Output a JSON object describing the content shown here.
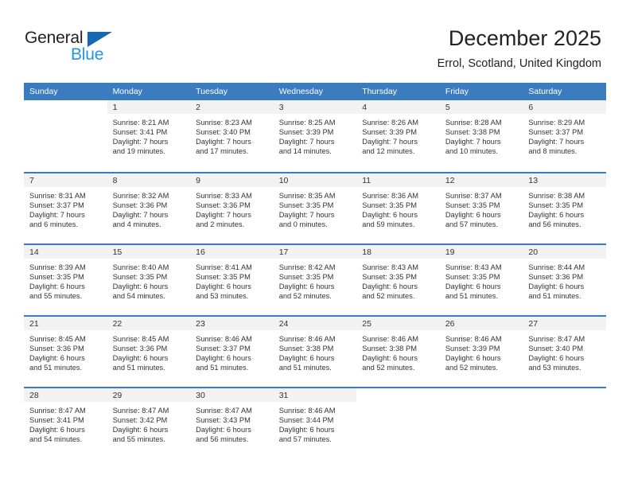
{
  "logo": {
    "text_dark": "General",
    "text_blue": "Blue",
    "accent_color": "#1668b3",
    "blue_color": "#2196e3"
  },
  "header": {
    "title": "December 2025",
    "subtitle": "Errol, Scotland, United Kingdom",
    "header_bg": "#3a7cbe",
    "band_bg": "#f2f2f2"
  },
  "weekday_headers": [
    "Sunday",
    "Monday",
    "Tuesday",
    "Wednesday",
    "Thursday",
    "Friday",
    "Saturday"
  ],
  "weeks": [
    [
      {
        "day": "",
        "sunrise": "",
        "sunset": "",
        "daylight_1": "",
        "daylight_2": ""
      },
      {
        "day": "1",
        "sunrise": "Sunrise: 8:21 AM",
        "sunset": "Sunset: 3:41 PM",
        "daylight_1": "Daylight: 7 hours",
        "daylight_2": "and 19 minutes."
      },
      {
        "day": "2",
        "sunrise": "Sunrise: 8:23 AM",
        "sunset": "Sunset: 3:40 PM",
        "daylight_1": "Daylight: 7 hours",
        "daylight_2": "and 17 minutes."
      },
      {
        "day": "3",
        "sunrise": "Sunrise: 8:25 AM",
        "sunset": "Sunset: 3:39 PM",
        "daylight_1": "Daylight: 7 hours",
        "daylight_2": "and 14 minutes."
      },
      {
        "day": "4",
        "sunrise": "Sunrise: 8:26 AM",
        "sunset": "Sunset: 3:39 PM",
        "daylight_1": "Daylight: 7 hours",
        "daylight_2": "and 12 minutes."
      },
      {
        "day": "5",
        "sunrise": "Sunrise: 8:28 AM",
        "sunset": "Sunset: 3:38 PM",
        "daylight_1": "Daylight: 7 hours",
        "daylight_2": "and 10 minutes."
      },
      {
        "day": "6",
        "sunrise": "Sunrise: 8:29 AM",
        "sunset": "Sunset: 3:37 PM",
        "daylight_1": "Daylight: 7 hours",
        "daylight_2": "and 8 minutes."
      }
    ],
    [
      {
        "day": "7",
        "sunrise": "Sunrise: 8:31 AM",
        "sunset": "Sunset: 3:37 PM",
        "daylight_1": "Daylight: 7 hours",
        "daylight_2": "and 6 minutes."
      },
      {
        "day": "8",
        "sunrise": "Sunrise: 8:32 AM",
        "sunset": "Sunset: 3:36 PM",
        "daylight_1": "Daylight: 7 hours",
        "daylight_2": "and 4 minutes."
      },
      {
        "day": "9",
        "sunrise": "Sunrise: 8:33 AM",
        "sunset": "Sunset: 3:36 PM",
        "daylight_1": "Daylight: 7 hours",
        "daylight_2": "and 2 minutes."
      },
      {
        "day": "10",
        "sunrise": "Sunrise: 8:35 AM",
        "sunset": "Sunset: 3:35 PM",
        "daylight_1": "Daylight: 7 hours",
        "daylight_2": "and 0 minutes."
      },
      {
        "day": "11",
        "sunrise": "Sunrise: 8:36 AM",
        "sunset": "Sunset: 3:35 PM",
        "daylight_1": "Daylight: 6 hours",
        "daylight_2": "and 59 minutes."
      },
      {
        "day": "12",
        "sunrise": "Sunrise: 8:37 AM",
        "sunset": "Sunset: 3:35 PM",
        "daylight_1": "Daylight: 6 hours",
        "daylight_2": "and 57 minutes."
      },
      {
        "day": "13",
        "sunrise": "Sunrise: 8:38 AM",
        "sunset": "Sunset: 3:35 PM",
        "daylight_1": "Daylight: 6 hours",
        "daylight_2": "and 56 minutes."
      }
    ],
    [
      {
        "day": "14",
        "sunrise": "Sunrise: 8:39 AM",
        "sunset": "Sunset: 3:35 PM",
        "daylight_1": "Daylight: 6 hours",
        "daylight_2": "and 55 minutes."
      },
      {
        "day": "15",
        "sunrise": "Sunrise: 8:40 AM",
        "sunset": "Sunset: 3:35 PM",
        "daylight_1": "Daylight: 6 hours",
        "daylight_2": "and 54 minutes."
      },
      {
        "day": "16",
        "sunrise": "Sunrise: 8:41 AM",
        "sunset": "Sunset: 3:35 PM",
        "daylight_1": "Daylight: 6 hours",
        "daylight_2": "and 53 minutes."
      },
      {
        "day": "17",
        "sunrise": "Sunrise: 8:42 AM",
        "sunset": "Sunset: 3:35 PM",
        "daylight_1": "Daylight: 6 hours",
        "daylight_2": "and 52 minutes."
      },
      {
        "day": "18",
        "sunrise": "Sunrise: 8:43 AM",
        "sunset": "Sunset: 3:35 PM",
        "daylight_1": "Daylight: 6 hours",
        "daylight_2": "and 52 minutes."
      },
      {
        "day": "19",
        "sunrise": "Sunrise: 8:43 AM",
        "sunset": "Sunset: 3:35 PM",
        "daylight_1": "Daylight: 6 hours",
        "daylight_2": "and 51 minutes."
      },
      {
        "day": "20",
        "sunrise": "Sunrise: 8:44 AM",
        "sunset": "Sunset: 3:36 PM",
        "daylight_1": "Daylight: 6 hours",
        "daylight_2": "and 51 minutes."
      }
    ],
    [
      {
        "day": "21",
        "sunrise": "Sunrise: 8:45 AM",
        "sunset": "Sunset: 3:36 PM",
        "daylight_1": "Daylight: 6 hours",
        "daylight_2": "and 51 minutes."
      },
      {
        "day": "22",
        "sunrise": "Sunrise: 8:45 AM",
        "sunset": "Sunset: 3:36 PM",
        "daylight_1": "Daylight: 6 hours",
        "daylight_2": "and 51 minutes."
      },
      {
        "day": "23",
        "sunrise": "Sunrise: 8:46 AM",
        "sunset": "Sunset: 3:37 PM",
        "daylight_1": "Daylight: 6 hours",
        "daylight_2": "and 51 minutes."
      },
      {
        "day": "24",
        "sunrise": "Sunrise: 8:46 AM",
        "sunset": "Sunset: 3:38 PM",
        "daylight_1": "Daylight: 6 hours",
        "daylight_2": "and 51 minutes."
      },
      {
        "day": "25",
        "sunrise": "Sunrise: 8:46 AM",
        "sunset": "Sunset: 3:38 PM",
        "daylight_1": "Daylight: 6 hours",
        "daylight_2": "and 52 minutes."
      },
      {
        "day": "26",
        "sunrise": "Sunrise: 8:46 AM",
        "sunset": "Sunset: 3:39 PM",
        "daylight_1": "Daylight: 6 hours",
        "daylight_2": "and 52 minutes."
      },
      {
        "day": "27",
        "sunrise": "Sunrise: 8:47 AM",
        "sunset": "Sunset: 3:40 PM",
        "daylight_1": "Daylight: 6 hours",
        "daylight_2": "and 53 minutes."
      }
    ],
    [
      {
        "day": "28",
        "sunrise": "Sunrise: 8:47 AM",
        "sunset": "Sunset: 3:41 PM",
        "daylight_1": "Daylight: 6 hours",
        "daylight_2": "and 54 minutes."
      },
      {
        "day": "29",
        "sunrise": "Sunrise: 8:47 AM",
        "sunset": "Sunset: 3:42 PM",
        "daylight_1": "Daylight: 6 hours",
        "daylight_2": "and 55 minutes."
      },
      {
        "day": "30",
        "sunrise": "Sunrise: 8:47 AM",
        "sunset": "Sunset: 3:43 PM",
        "daylight_1": "Daylight: 6 hours",
        "daylight_2": "and 56 minutes."
      },
      {
        "day": "31",
        "sunrise": "Sunrise: 8:46 AM",
        "sunset": "Sunset: 3:44 PM",
        "daylight_1": "Daylight: 6 hours",
        "daylight_2": "and 57 minutes."
      },
      {
        "day": "",
        "sunrise": "",
        "sunset": "",
        "daylight_1": "",
        "daylight_2": ""
      },
      {
        "day": "",
        "sunrise": "",
        "sunset": "",
        "daylight_1": "",
        "daylight_2": ""
      },
      {
        "day": "",
        "sunrise": "",
        "sunset": "",
        "daylight_1": "",
        "daylight_2": ""
      }
    ]
  ]
}
